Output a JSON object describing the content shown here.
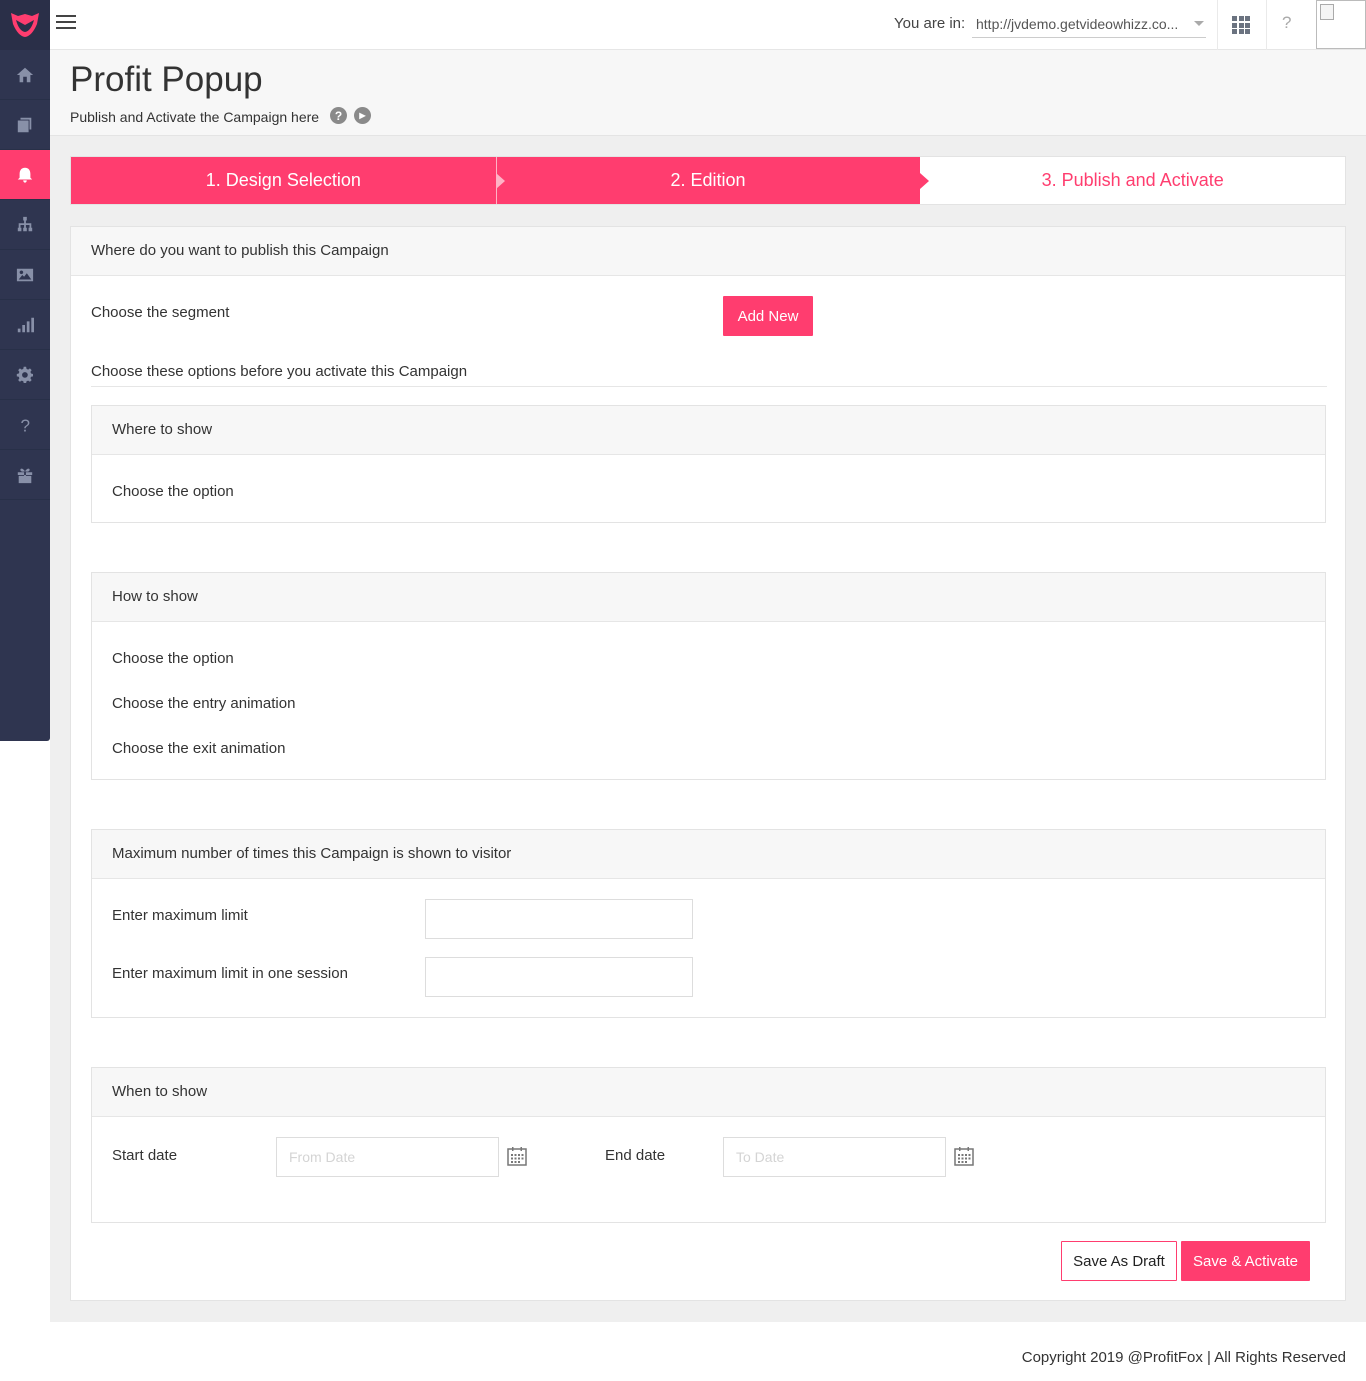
{
  "header": {
    "you_are_in_label": "You are in:",
    "site_url": "http://jvdemo.getvideowhizz.co...",
    "help_label": "?"
  },
  "sidebar": {
    "items": [
      {
        "name": "home-icon",
        "active": false
      },
      {
        "name": "pages-icon",
        "active": false
      },
      {
        "name": "bell-icon",
        "active": true
      },
      {
        "name": "sitemap-icon",
        "active": false
      },
      {
        "name": "image-icon",
        "active": false
      },
      {
        "name": "bar-chart-icon",
        "active": false
      },
      {
        "name": "gear-icon",
        "active": false
      },
      {
        "name": "question-icon",
        "active": false
      },
      {
        "name": "gift-icon",
        "active": false
      }
    ]
  },
  "page": {
    "title": "Profit Popup",
    "subtitle": "Publish and Activate the Campaign here",
    "help_icon_glyph": "?",
    "play_icon_glyph": "▶"
  },
  "steps": [
    {
      "label": "1. Design Selection",
      "state": "done"
    },
    {
      "label": "2. Edition",
      "state": "current"
    },
    {
      "label": "3. Publish and Activate",
      "state": "pending"
    }
  ],
  "card": {
    "heading": "Where do you want to publish this Campaign",
    "segment_label": "Choose the segment",
    "add_new_label": "Add New",
    "options_heading": "Choose these options before you activate this Campaign"
  },
  "where_to_show": {
    "title": "Where to show",
    "option_label": "Choose the option"
  },
  "how_to_show": {
    "title": "How to show",
    "option_label": "Choose the option",
    "entry_label": "Choose the entry animation",
    "exit_label": "Choose the exit animation"
  },
  "max_times": {
    "title": "Maximum number of times this Campaign is shown to visitor",
    "limit_label": "Enter maximum limit",
    "limit_value": "",
    "session_label": "Enter maximum limit in one session",
    "session_value": ""
  },
  "when_to_show": {
    "title": "When to show",
    "start_label": "Start date",
    "start_placeholder": "From Date",
    "end_label": "End date",
    "end_placeholder": "To Date"
  },
  "actions": {
    "draft_label": "Save As Draft",
    "activate_label": "Save & Activate"
  },
  "footer": {
    "copyright": "Copyright 2019 @ProfitFox | All Rights Reserved"
  },
  "colors": {
    "accent": "#ff3d6f",
    "sidebar_bg": "#2f3550"
  }
}
